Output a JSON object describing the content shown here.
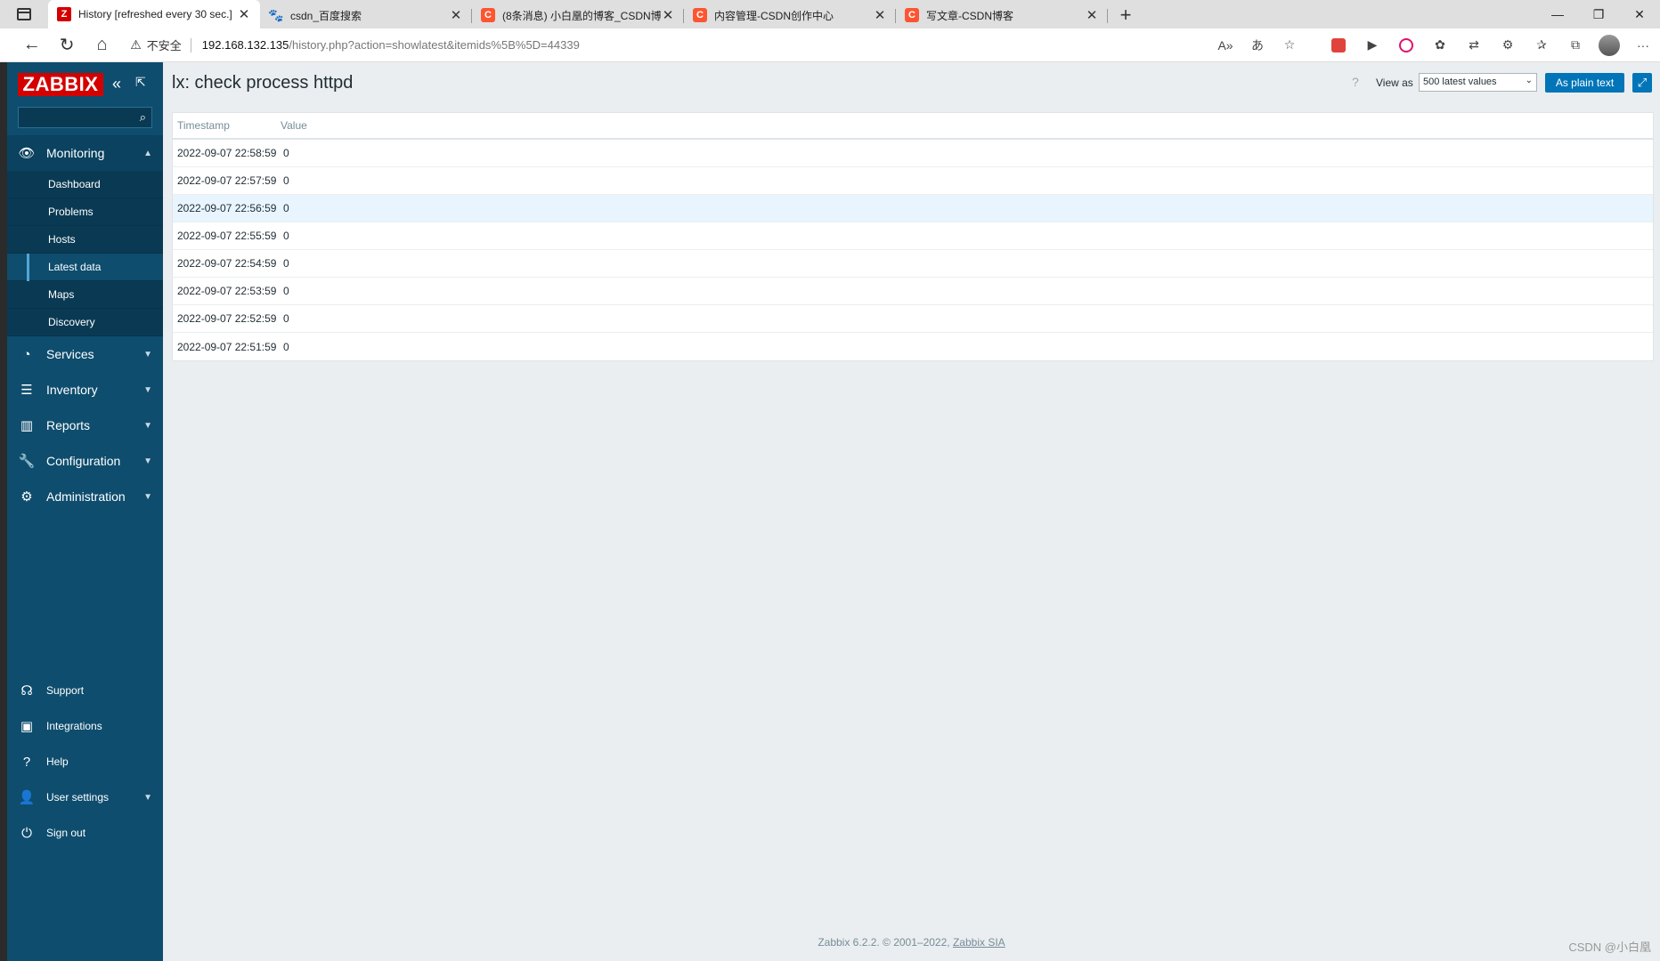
{
  "browser": {
    "tabs": [
      {
        "title": "History [refreshed every 30 sec.]",
        "icon": "zabbix-icon",
        "active": true
      },
      {
        "title": "csdn_百度搜索",
        "icon": "baidu-icon",
        "active": false
      },
      {
        "title": "(8条消息) 小白凰的博客_CSDN博",
        "icon": "csdn-icon",
        "active": false
      },
      {
        "title": "内容管理-CSDN创作中心",
        "icon": "csdn-icon",
        "active": false
      },
      {
        "title": "写文章-CSDN博客",
        "icon": "csdn-icon",
        "active": false
      }
    ],
    "security_label": "不安全",
    "url_host": "192.168.132.135",
    "url_path": "/history.php?action=showlatest&itemids%5B%5D=44339"
  },
  "sidebar": {
    "logo": "ZABBIX",
    "search_placeholder": "",
    "monitoring": {
      "label": "Monitoring",
      "items": [
        {
          "label": "Dashboard"
        },
        {
          "label": "Problems"
        },
        {
          "label": "Hosts"
        },
        {
          "label": "Latest data"
        },
        {
          "label": "Maps"
        },
        {
          "label": "Discovery"
        }
      ],
      "selected": "Latest data"
    },
    "sections": [
      {
        "label": "Services"
      },
      {
        "label": "Inventory"
      },
      {
        "label": "Reports"
      },
      {
        "label": "Configuration"
      },
      {
        "label": "Administration"
      }
    ],
    "bottom": [
      {
        "label": "Support"
      },
      {
        "label": "Integrations"
      },
      {
        "label": "Help"
      },
      {
        "label": "User settings"
      },
      {
        "label": "Sign out"
      }
    ]
  },
  "page": {
    "title": "lx: check process httpd",
    "view_as_label": "View as",
    "view_as_value": "500 latest values",
    "plain_text_button": "As plain text",
    "table": {
      "headers": {
        "timestamp": "Timestamp",
        "value": "Value"
      },
      "rows": [
        {
          "timestamp": "2022-09-07 22:58:59",
          "value": "0"
        },
        {
          "timestamp": "2022-09-07 22:57:59",
          "value": "0"
        },
        {
          "timestamp": "2022-09-07 22:56:59",
          "value": "0"
        },
        {
          "timestamp": "2022-09-07 22:55:59",
          "value": "0"
        },
        {
          "timestamp": "2022-09-07 22:54:59",
          "value": "0"
        },
        {
          "timestamp": "2022-09-07 22:53:59",
          "value": "0"
        },
        {
          "timestamp": "2022-09-07 22:52:59",
          "value": "0"
        },
        {
          "timestamp": "2022-09-07 22:51:59",
          "value": "0"
        }
      ],
      "highlighted_row": 2
    }
  },
  "footer": {
    "text": "Zabbix 6.2.2. © 2001–2022,",
    "link": "Zabbix SIA"
  },
  "watermark": "CSDN @小白凰",
  "colors": {
    "sidebar": "#0e4d6e",
    "accent": "#0275b8",
    "logo": "#d40000",
    "row_highlight": "#e8f5ff"
  }
}
